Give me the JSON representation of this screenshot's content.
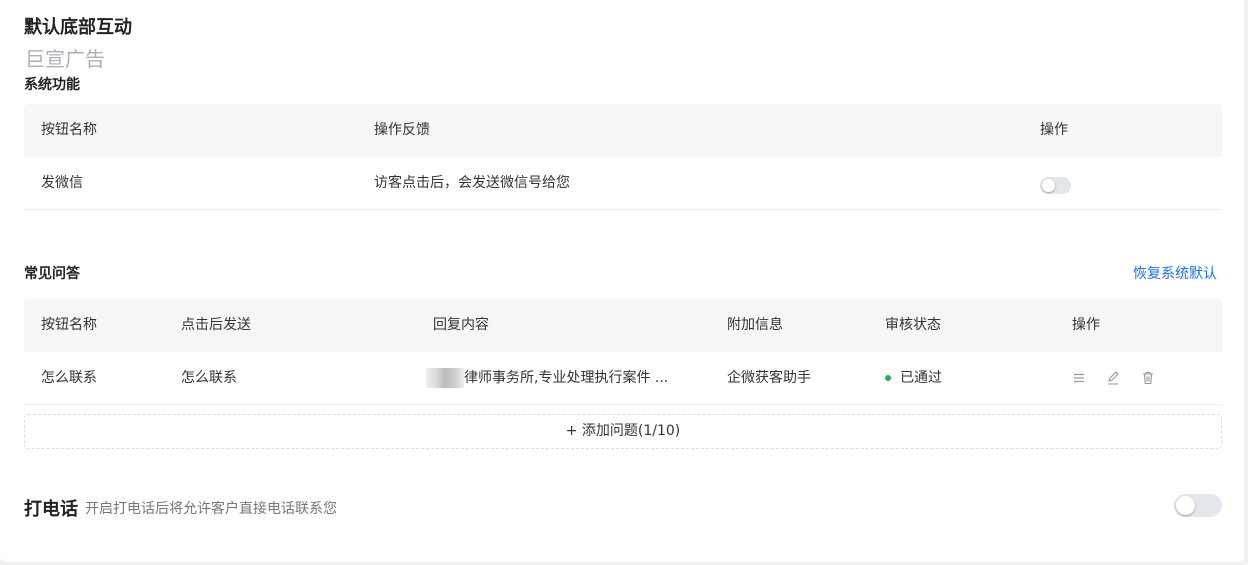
{
  "header": {
    "title": "默认底部互动",
    "subtitle": "巨宣广告"
  },
  "system": {
    "title": "系统功能",
    "columns": [
      "按钮名称",
      "操作反馈",
      "操作"
    ],
    "rows": [
      {
        "name": "发微信",
        "feedback": "访客点击后，会发送微信号给您",
        "enabled": false
      }
    ]
  },
  "faq": {
    "title": "常见问答",
    "restore_label": "恢复系统默认",
    "columns": [
      "按钮名称",
      "点击后发送",
      "回复内容",
      "附加信息",
      "审核状态",
      "操作"
    ],
    "rows": [
      {
        "name": "怎么联系",
        "send": "怎么联系",
        "reply": "律师事务所,专业处理执行案件 ...",
        "extra": "企微获客助手",
        "status": "已通过"
      }
    ],
    "add_label": "+ 添加问题(1/10)"
  },
  "phone": {
    "title": "打电话",
    "desc": "开启打电话后将允许客户直接电话联系您",
    "enabled": false
  },
  "colors": {
    "accent": "#1f6fff",
    "success": "#20b05a"
  }
}
